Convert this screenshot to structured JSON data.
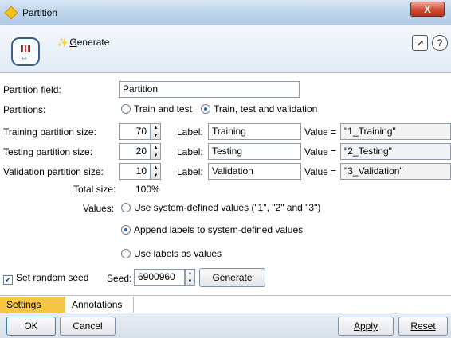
{
  "window": {
    "title": "Partition",
    "close_label": "X"
  },
  "toolbar": {
    "generate_label": "Generate",
    "generate_mnemonic": "G",
    "generate_rest": "enerate"
  },
  "form": {
    "partition_field_label": "Partition field:",
    "partition_field_value": "Partition",
    "partitions_label": "Partitions:",
    "partitions_options": [
      {
        "label": "Train and test",
        "selected": false
      },
      {
        "label": "Train, test and validation",
        "selected": true
      }
    ],
    "rows": [
      {
        "size_label": "Training partition size:",
        "size": "70",
        "label_caption": "Label:",
        "label_value": "Training",
        "value_caption": "Value =",
        "value": "\"1_Training\""
      },
      {
        "size_label": "Testing partition size:",
        "size": "20",
        "label_caption": "Label:",
        "label_value": "Testing",
        "value_caption": "Value =",
        "value": "\"2_Testing\""
      },
      {
        "size_label": "Validation partition size:",
        "size": "10",
        "label_caption": "Label:",
        "label_value": "Validation",
        "value_caption": "Value =",
        "value": "\"3_Validation\""
      }
    ],
    "total_size_label": "Total size:",
    "total_size_value": "100%",
    "values_label": "Values:",
    "values_options": [
      {
        "label": "Use system-defined values (\"1\", \"2\" and \"3\")",
        "selected": false
      },
      {
        "label": "Append labels to system-defined values",
        "selected": true
      },
      {
        "label": "Use labels as values",
        "selected": false
      }
    ],
    "seed_check_label": "Set random seed",
    "seed_checked": true,
    "seed_label": "Seed:",
    "seed_value": "6900960",
    "generate_button": "Generate"
  },
  "tabs": [
    {
      "label": "Settings",
      "active": true
    },
    {
      "label": "Annotations",
      "active": false
    }
  ],
  "buttons": {
    "ok": "OK",
    "cancel": "Cancel",
    "apply": "Apply",
    "reset": "Reset"
  },
  "colors": {
    "active_tab": "#f6c744",
    "accent": "#2b63b8"
  }
}
